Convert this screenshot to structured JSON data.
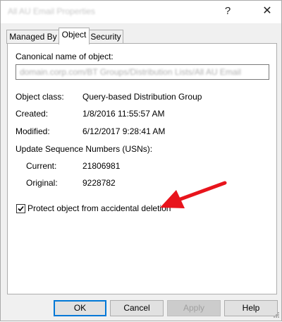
{
  "window": {
    "title": "All AU Email Properties",
    "help_glyph": "?",
    "close_glyph": "✕"
  },
  "tabs": [
    {
      "label": "Managed By",
      "active": false
    },
    {
      "label": "Object",
      "active": true
    },
    {
      "label": "Security",
      "active": false
    }
  ],
  "object": {
    "canonical_label": "Canonical name of object:",
    "canonical_value": "domain.corp.com/BT Groups/Distribution Lists/All AU Email",
    "class_label": "Object class:",
    "class_value": "Query-based Distribution Group",
    "created_label": "Created:",
    "created_value": "1/8/2016 11:55:57 AM",
    "modified_label": "Modified:",
    "modified_value": "6/12/2017 9:28:41 AM",
    "usn_label": "Update Sequence Numbers (USNs):",
    "current_label": "Current:",
    "current_value": "21806981",
    "original_label": "Original:",
    "original_value": "9228782",
    "protect_label": "Protect object from accidental deletion",
    "protect_checked": true
  },
  "buttons": {
    "ok": "OK",
    "cancel": "Cancel",
    "apply": "Apply",
    "help": "Help"
  },
  "colors": {
    "annotation_arrow": "#e8141c",
    "focus_border": "#0078d7"
  }
}
